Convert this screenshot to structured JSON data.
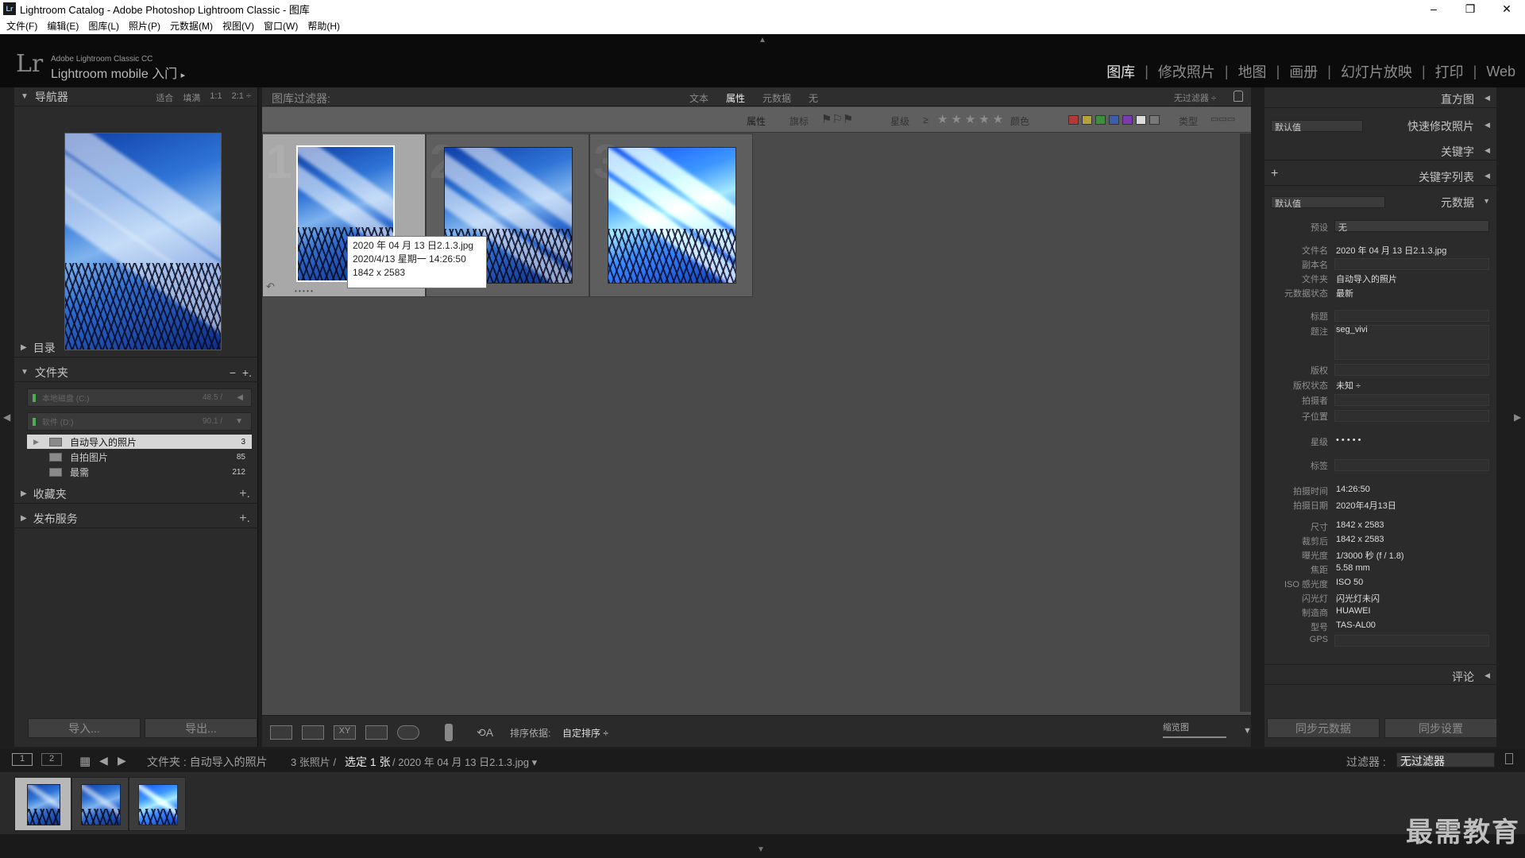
{
  "window": {
    "title": "Lightroom Catalog - Adobe Photoshop Lightroom Classic - 图库",
    "icon_text": "Lr",
    "minimize": "–",
    "maximize": "❐",
    "close": "✕"
  },
  "menu": [
    "文件(F)",
    "编辑(E)",
    "图库(L)",
    "照片(P)",
    "元数据(M)",
    "视图(V)",
    "窗口(W)",
    "帮助(H)"
  ],
  "identity": {
    "logo": "Lr",
    "small": "Adobe Lightroom Classic CC",
    "big": "Lightroom mobile 入门",
    "arrow": "▸"
  },
  "modules": [
    "图库",
    "修改照片",
    "地图",
    "画册",
    "幻灯片放映",
    "打印",
    "Web"
  ],
  "active_module": "图库",
  "left": {
    "navigator": {
      "title": "导航器",
      "options": [
        "适合",
        "填满",
        "1:1",
        "2:1 ÷"
      ]
    },
    "catalog": {
      "title": "目录"
    },
    "folders": {
      "title": "文件夹",
      "minus": "−",
      "plus": "+.",
      "volumes": [
        {
          "name": "本地磁盘 (C:)",
          "cap": "48.5 /"
        },
        {
          "name": "软件 (D:)",
          "cap": "90.1 /"
        }
      ],
      "items": [
        {
          "name": "自动导入的照片",
          "count": "3"
        },
        {
          "name": "自拍图片",
          "count": "85"
        },
        {
          "name": "最需",
          "count": "212"
        }
      ]
    },
    "collections": {
      "title": "收藏夹",
      "plus": "+."
    },
    "publish": {
      "title": "发布服务",
      "plus": "+."
    },
    "import_btn": "导入...",
    "export_btn": "导出..."
  },
  "filter": {
    "label": "图库过滤器:",
    "tabs": [
      "文本",
      "属性",
      "元数据",
      "无"
    ],
    "active": "属性",
    "preset": "无过滤器 ÷"
  },
  "attr": {
    "attribute": "属性",
    "flag": "旗标",
    "rating": "星级",
    "ge": "≥",
    "stars": "★★★★★",
    "color": "颜色",
    "kind": "类型",
    "colors": [
      "#b03a3a",
      "#b5a33a",
      "#3d8f3d",
      "#3a5fb0",
      "#7b3ab0",
      "#dcdcdc",
      "#777777"
    ]
  },
  "grid": {
    "cells": [
      {
        "num": "1"
      },
      {
        "num": "2"
      },
      {
        "num": "3"
      }
    ],
    "dots": "• • • • •"
  },
  "tooltip": {
    "line1": "2020 年 04 月 13 日2.1.3.jpg",
    "line2": "2020/4/13 星期一 14:26:50",
    "line3": "1842 x 2583"
  },
  "toolbar": {
    "sort_label": "排序依据:",
    "sort_value": "自定排序 ÷",
    "thumbs": "缩览图",
    "xy": "XY"
  },
  "right": {
    "histogram": "直方图",
    "quick_develop": "快速修改照片",
    "quick_preset": "默认值",
    "keywording": "关键字",
    "keyword_list": "关键字列表",
    "keyword_plus": "+",
    "metadata": "元数据",
    "meta_preset": "默认值",
    "comments": "评论",
    "sync_meta": "同步元数据",
    "sync_settings": "同步设置",
    "fields": {
      "preset_k": "预设",
      "preset_v": "无",
      "filename_k": "文件名",
      "filename_v": "2020 年 04 月 13 日2.1.3.jpg",
      "copy_k": "副本名",
      "folder_k": "文件夹",
      "folder_v": "自动导入的照片",
      "status_k": "元数据状态",
      "status_v": "最新",
      "title_k": "标题",
      "caption_k": "题注",
      "caption_v": "seg_vivi",
      "copyright_k": "版权",
      "crstatus_k": "版权状态",
      "crstatus_v": "未知 ÷",
      "creator_k": "拍摄者",
      "sublocation_k": "子位置",
      "rating_k": "星级",
      "rating_v": "• • • • •",
      "label_k": "标签",
      "time_k": "拍摄时间",
      "time_v": "14:26:50",
      "date_k": "拍摄日期",
      "date_v": "2020年4月13日",
      "dim_k": "尺寸",
      "dim_v": "1842 x 2583",
      "crop_k": "裁剪后",
      "crop_v": "1842 x 2583",
      "exposure_k": "曝光度",
      "exposure_v": "1/3000 秒 (f / 1.8)",
      "focal_k": "焦距",
      "focal_v": "5.58 mm",
      "iso_k": "ISO 感光度",
      "iso_v": "ISO 50",
      "flash_k": "闪光灯",
      "flash_v": "闪光灯未闪",
      "make_k": "制造商",
      "make_v": "HUAWEI",
      "model_k": "型号",
      "model_v": "TAS-AL00",
      "gps_k": "GPS"
    }
  },
  "filmbar": {
    "page1": "1",
    "page2": "2",
    "path": "文件夹 : 自动导入的照片",
    "count": "3 张照片 / ",
    "selected": "选定 1 张",
    "file": " / 2020 年 04 月 13 日2.1.3.jpg ▾",
    "filter_label": "过滤器 :",
    "filter_value": "无过滤器"
  },
  "watermark": "最需教育"
}
